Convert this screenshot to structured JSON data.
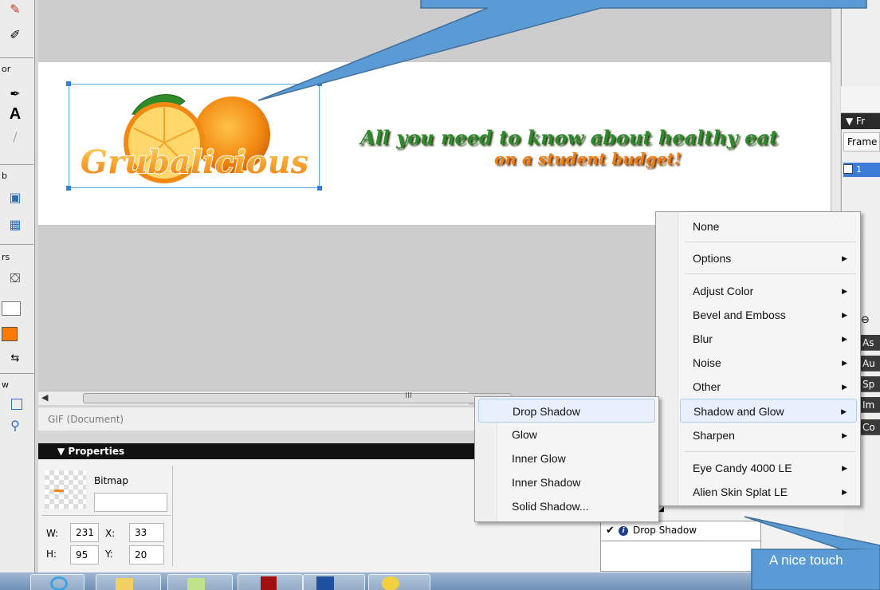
{
  "document": {
    "headline_line1": "All you need to know about healthy eat",
    "headline_line2": "on a student budget!",
    "logo_text": "Grubalicious",
    "status_text": "GIF (Document)",
    "hscroll_grip": "III"
  },
  "tools": {
    "labels": [
      "or",
      "b",
      "rs",
      "w"
    ]
  },
  "right_panel": {
    "frames_header": "▼ Fr",
    "frames_tab": "Frame",
    "frame_row": "1",
    "tabs": [
      "As",
      "Au",
      "Sp",
      "Im",
      "Co"
    ]
  },
  "properties": {
    "header": "▼ Properties",
    "type": "Bitmap",
    "name_value": "",
    "w_label": "W:",
    "w_value": "231",
    "h_label": "H:",
    "h_value": "95",
    "x_label": "X:",
    "x_value": "33",
    "y_label": "Y:",
    "y_value": "20",
    "filter_item": "Drop Shadow"
  },
  "filter_menu": {
    "items": [
      {
        "label": "None",
        "submenu": false
      },
      {
        "label": "Options",
        "submenu": true
      },
      {
        "label": "Adjust Color",
        "submenu": true
      },
      {
        "label": "Bevel and Emboss",
        "submenu": true
      },
      {
        "label": "Blur",
        "submenu": true
      },
      {
        "label": "Noise",
        "submenu": true
      },
      {
        "label": "Other",
        "submenu": true
      },
      {
        "label": "Shadow and Glow",
        "submenu": true
      },
      {
        "label": "Sharpen",
        "submenu": true
      },
      {
        "label": "Eye Candy 4000 LE",
        "submenu": true
      },
      {
        "label": "Alien Skin Splat LE",
        "submenu": true
      }
    ],
    "highlighted": "Shadow and Glow"
  },
  "shadow_submenu": {
    "items": [
      "Drop Shadow",
      "Glow",
      "Inner Glow",
      "Inner Shadow",
      "Solid Shadow..."
    ],
    "highlighted": "Drop Shadow"
  },
  "callout": {
    "bottom_text": "A nice touch"
  },
  "colors": {
    "callout_fill": "#5b9bd5",
    "callout_border": "#41719c",
    "headline_green": "#2d8a2d",
    "headline_orange": "#ef7d15",
    "selection_blue": "#2f7fe0"
  }
}
